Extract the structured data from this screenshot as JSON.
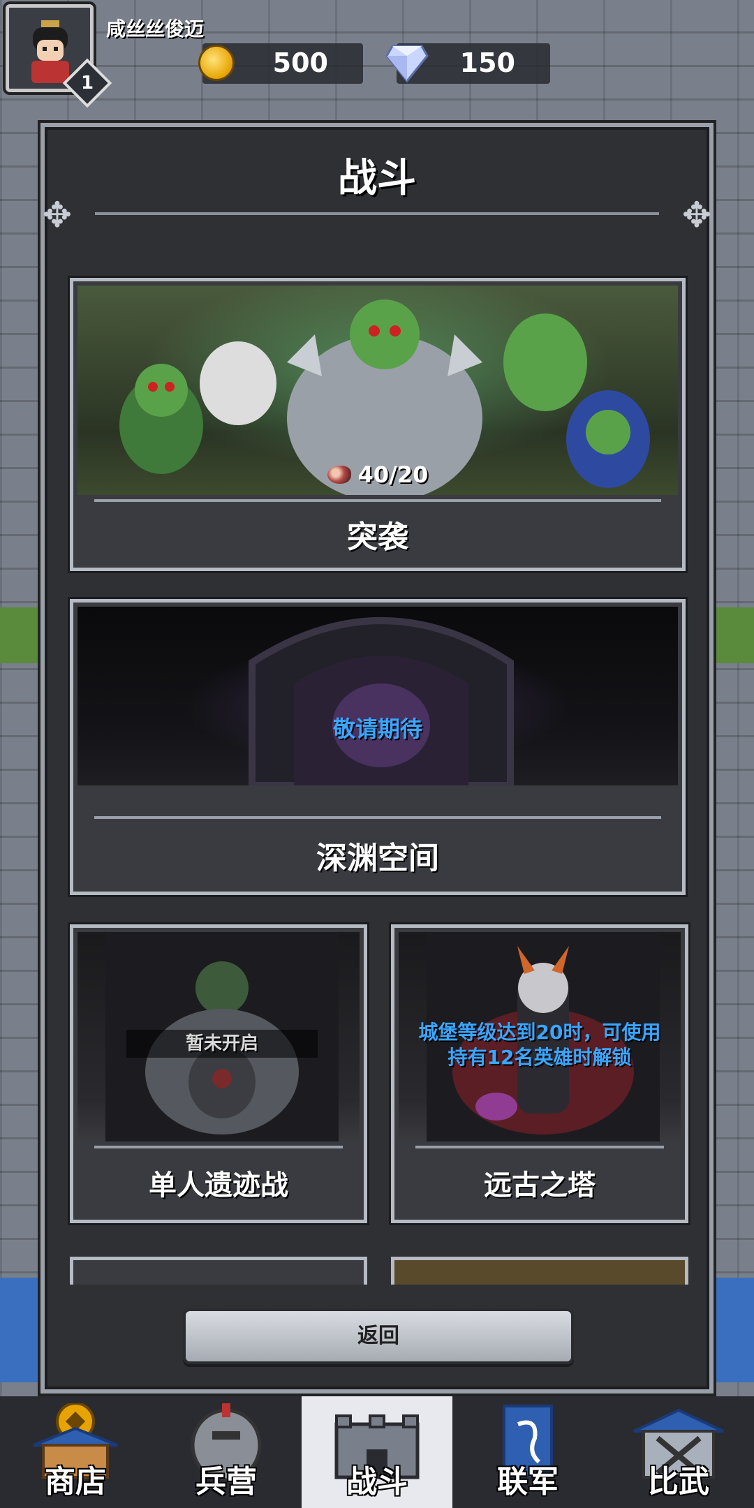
{
  "player": {
    "name": "咸丝丝俊迈",
    "level": "1"
  },
  "resources": {
    "gold": "500",
    "gems": "150"
  },
  "panel": {
    "title": "战斗"
  },
  "modes": {
    "raid": {
      "label": "突袭",
      "count": "40/20"
    },
    "abyss": {
      "label": "深渊空间",
      "status": "敬请期待"
    },
    "ruins": {
      "label": "单人遗迹战",
      "status": "暂未开启"
    },
    "tower": {
      "label": "远古之塔",
      "lock_line1": "城堡等级达到20时，可使用",
      "lock_line2": "持有12名英雄时解锁"
    }
  },
  "back_label": "返回",
  "nav": [
    {
      "label": "商店",
      "icon": "shop-icon"
    },
    {
      "label": "兵营",
      "icon": "barracks-icon"
    },
    {
      "label": "战斗",
      "icon": "battle-icon",
      "active": true
    },
    {
      "label": "联军",
      "icon": "alliance-icon"
    },
    {
      "label": "比武",
      "icon": "arena-icon"
    }
  ],
  "colors": {
    "accent_blue": "#3aa6ff",
    "panel_bg": "#2f3034"
  }
}
